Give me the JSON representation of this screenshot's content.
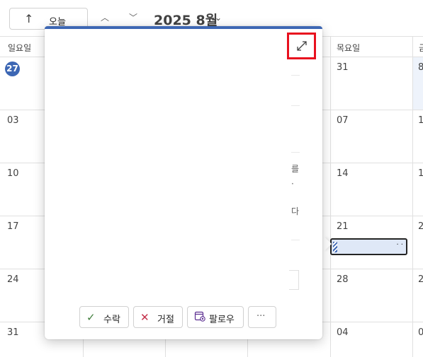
{
  "toolbar": {
    "today_label": "오늘",
    "month_title": "2025 8월"
  },
  "calendar": {
    "weekday_headers": [
      "일요일",
      "목요일",
      "금"
    ],
    "today_date": "27",
    "days": {
      "w1_sun": "27",
      "w1_thu": "31",
      "w1_fri": "8",
      "w2_sun": "03",
      "w2_thu": "07",
      "w2_fri": "1",
      "w3_sun": "10",
      "w3_thu": "14",
      "w3_fri": "1",
      "w4_sun": "17",
      "w4_thu": "21",
      "w4_fri": "2",
      "w5_sun": "24",
      "w5_thu": "28",
      "w5_fri": "2",
      "w6_sun": "31",
      "w6_thu": "04",
      "w6_fri": "0"
    },
    "accent_color": "#3d67b4"
  },
  "popup": {
    "partial_chars": [
      "를",
      "·",
      "다"
    ],
    "actions": {
      "accept": "수락",
      "decline": "거절",
      "follow": "팔로우",
      "more": "···"
    },
    "highlight_color": "#e8101e"
  }
}
